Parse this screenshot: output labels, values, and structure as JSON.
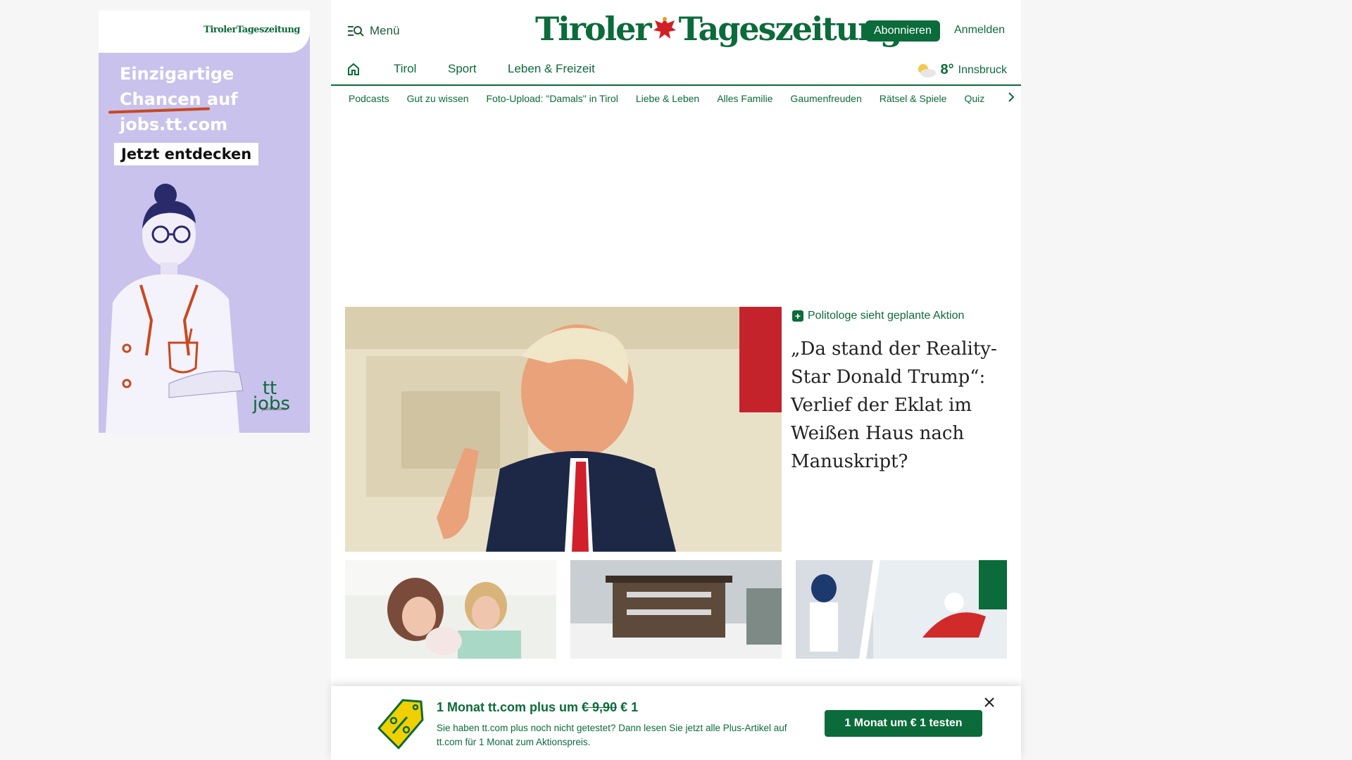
{
  "ad": {
    "logo": "TirolerTageszeitung",
    "headline_line1": "Einzigartige",
    "headline_line2": "Chancen auf",
    "headline_line3": "jobs.tt.com",
    "cta": "Jetzt entdecken",
    "brand_tt": "tt",
    "brand_jobs": "jobs",
    "brand_url": "jobs.tt.com"
  },
  "header": {
    "menu_label": "Menü",
    "logo_left": "Tiroler",
    "logo_right": "Tageszeitung",
    "subscribe_label": "Abonnieren",
    "login_label": "Anmelden"
  },
  "nav": {
    "items": [
      "Tirol",
      "Sport",
      "Leben & Freizeit"
    ],
    "weather_temp": "8°",
    "weather_city": "Innsbruck"
  },
  "subnav": {
    "items": [
      "Podcasts",
      "Gut zu wissen",
      "Foto-Upload: \"Damals\" in Tirol",
      "Liebe & Leben",
      "Alles Familie",
      "Gaumenfreuden",
      "Rätsel & Spiele",
      "Quiz"
    ]
  },
  "lead": {
    "kicker": "Politologe sieht geplante Aktion",
    "headline": "„Da stand der Reality-Star Donald Trump“: Verlief der Eklat im Weißen Haus nach Manuskript?"
  },
  "promo": {
    "title_prefix": "1 Monat tt.com plus um",
    "old_price": "€ 9,90",
    "new_price": "€ 1",
    "text": "Sie haben tt.com plus noch nicht getestet? Dann lesen Sie jetzt alle Plus-Artikel auf tt.com für 1 Monat zum Aktionspreis.",
    "button_label": "1 Monat um € 1 testen"
  },
  "colors": {
    "brand_green": "#0b6b3a",
    "ad_lavender": "#c9c2ec",
    "accent_red": "#c8481f"
  }
}
